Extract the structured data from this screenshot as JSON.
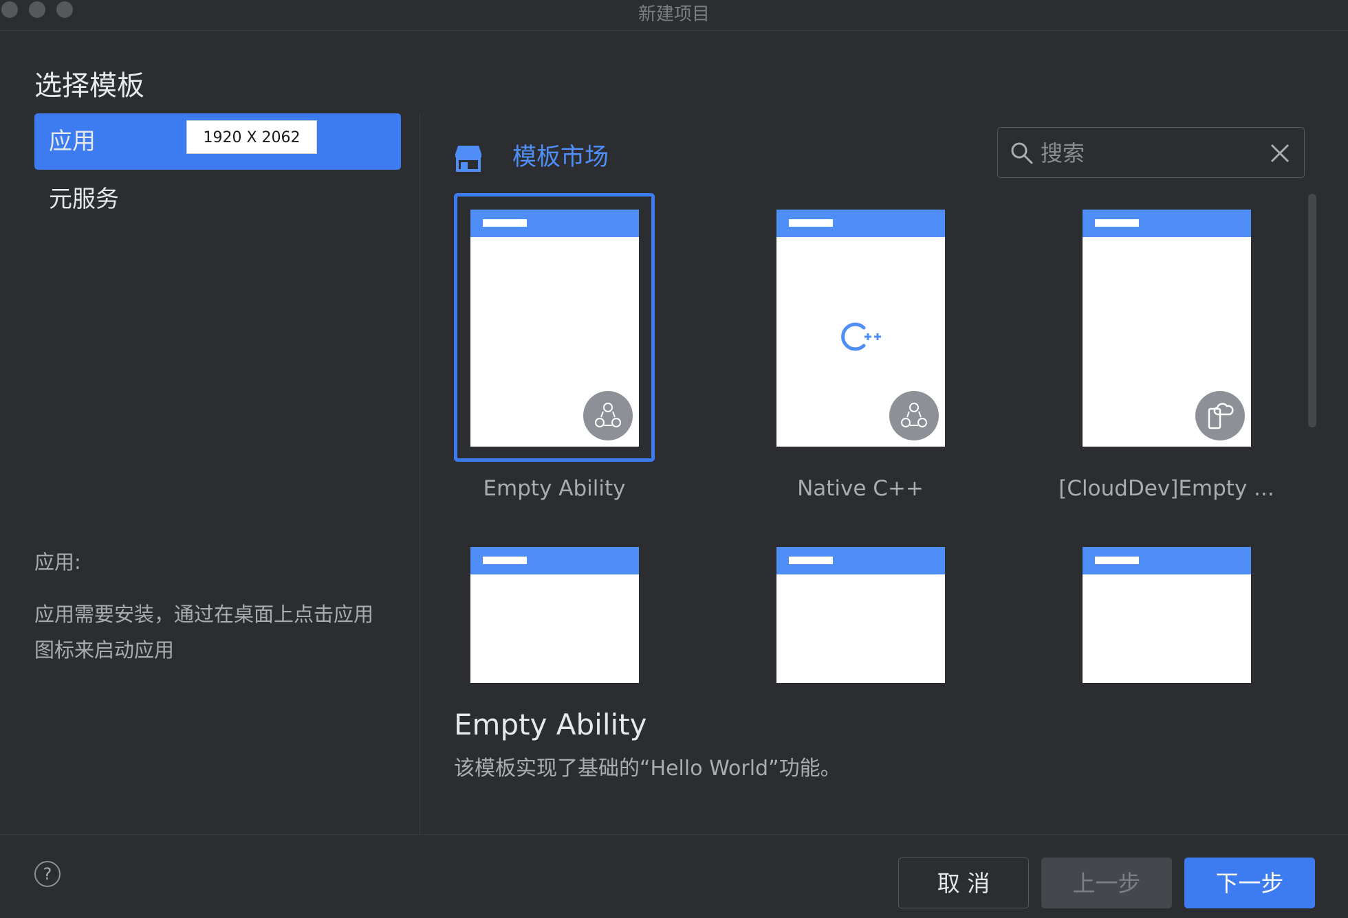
{
  "window": {
    "title": "新建项目"
  },
  "heading": "选择模板",
  "categories": [
    {
      "label": "应用",
      "active": true
    },
    {
      "label": "元服务",
      "active": false
    }
  ],
  "tooltip": "1920 X 2062",
  "category_description": {
    "title": "应用:",
    "body": "应用需要安装，通过在桌面上点击应用图标来启动应用"
  },
  "market": {
    "label": "模板市场",
    "icon": "store-icon"
  },
  "search": {
    "placeholder": "搜索",
    "value": ""
  },
  "templates": [
    {
      "label": "Empty Ability",
      "selected": true,
      "badge": "ability-icon"
    },
    {
      "label": "Native C++",
      "selected": false,
      "badge": "ability-icon",
      "center_icon": "cpp-icon"
    },
    {
      "label": "[CloudDev]Empty ...",
      "selected": false,
      "badge": "cloud-phone-icon"
    },
    {
      "label": "",
      "selected": false
    },
    {
      "label": "",
      "selected": false
    },
    {
      "label": "",
      "selected": false
    }
  ],
  "detail": {
    "title": "Empty Ability",
    "description": "该模板实现了基础的“Hello World”功能。"
  },
  "buttons": {
    "cancel": "取 消",
    "previous": "上一步",
    "next": "下一步"
  },
  "colors": {
    "accent": "#3d7bf0",
    "card_header": "#4f8ef7",
    "background": "#2b2d31"
  }
}
